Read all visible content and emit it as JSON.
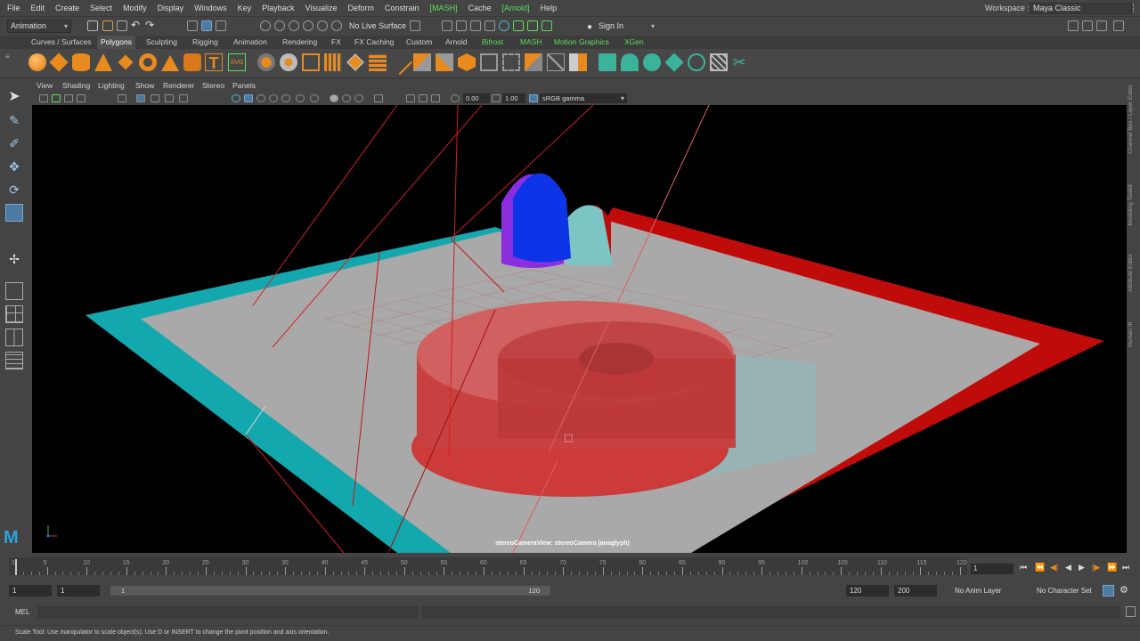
{
  "menubar": {
    "items": [
      "File",
      "Edit",
      "Create",
      "Select",
      "Modify",
      "Display",
      "Windows",
      "Key",
      "Playback",
      "Visualize",
      "Deform",
      "Constrain",
      "[MASH]",
      "Cache",
      "[Arnold]",
      "Help"
    ],
    "workspace_label": "Workspace :",
    "workspace_value": "Maya Classic"
  },
  "statusline": {
    "mode": "Animation",
    "live_surface": "No Live Surface",
    "sign_in": "Sign In"
  },
  "shelf": {
    "tabs": [
      "Curves / Surfaces",
      "Polygons",
      "Sculpting",
      "Rigging",
      "Animation",
      "Rendering",
      "FX",
      "FX Caching",
      "Custom",
      "Arnold",
      "Bifrost",
      "MASH",
      "Motion Graphics",
      "XGen"
    ],
    "active_tab": "Polygons"
  },
  "panel": {
    "menus": [
      "View",
      "Shading",
      "Lighting",
      "Show",
      "Renderer",
      "Stereo",
      "Panels"
    ],
    "exposure": "0.00",
    "gamma": "1.00",
    "color_space": "sRGB gamma",
    "camera_label": "stereoCameraView: stereoCamera (anaglyph)"
  },
  "right_tabs": [
    "Channel Box / Layer Editor",
    "Modeling Toolkit",
    "Attribute Editor",
    "Human IK"
  ],
  "timeline": {
    "ticks": [
      "1",
      "5",
      "10",
      "15",
      "20",
      "25",
      "30",
      "35",
      "40",
      "45",
      "50",
      "55",
      "60",
      "65",
      "70",
      "75",
      "80",
      "85",
      "90",
      "95",
      "100",
      "105",
      "110",
      "115",
      "120"
    ],
    "current_frame": "1"
  },
  "range": {
    "start": "1",
    "playback_start": "1",
    "bar_start": "1",
    "bar_end": "120",
    "playback_end": "120",
    "end": "200",
    "anim_layer": "No Anim Layer",
    "character_set": "No Character Set"
  },
  "command": {
    "mel_label": "MEL"
  },
  "help_line": "Scale Tool: Use manipulator to scale object(s). Use D or INSERT to change the pivot position and axis orientation.",
  "colors": {
    "ui_bg": "#444444",
    "accent_blue": "#4d7aa0",
    "green_tag": "#5fdc5f",
    "anaglyph_red": "#d01010",
    "anaglyph_cyan": "#12b3b8"
  }
}
